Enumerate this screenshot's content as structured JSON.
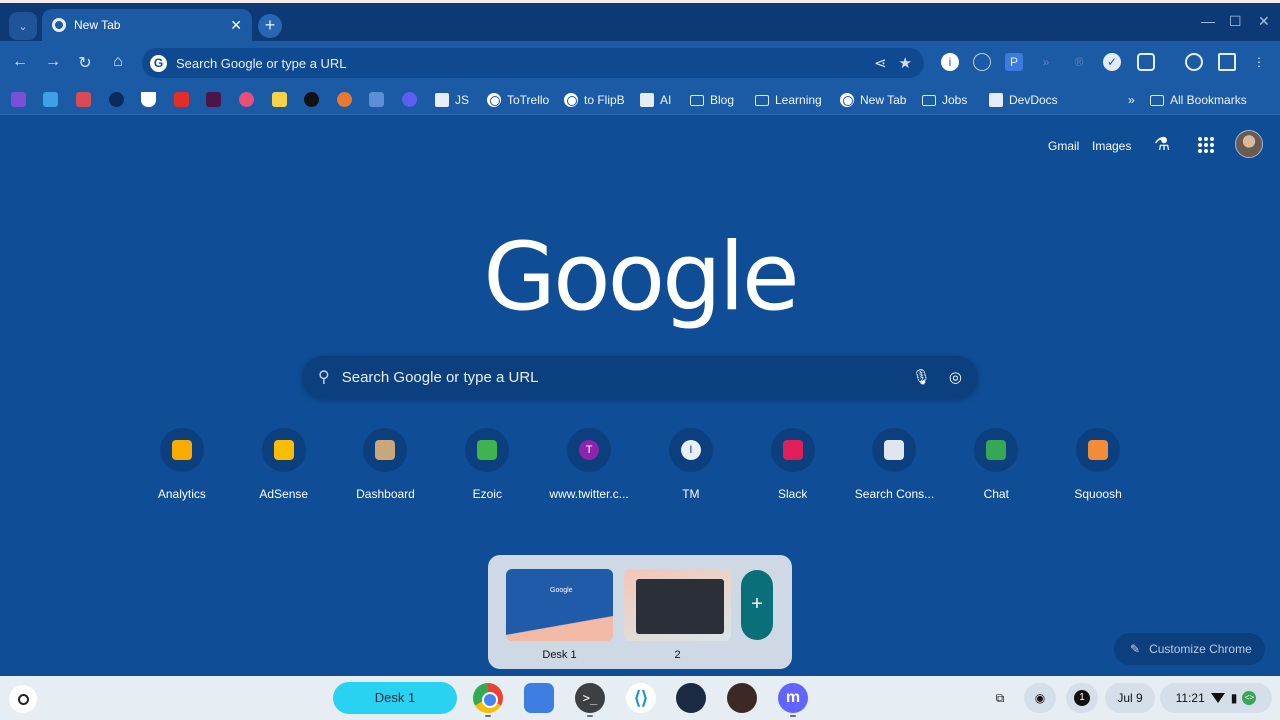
{
  "browser": {
    "tab": {
      "title": "New Tab",
      "close": "✕"
    },
    "new_tab_icon": "+",
    "window_controls": [
      "—",
      "☐",
      "✕"
    ],
    "omnibox": {
      "text": "Search Google or type a URL"
    },
    "bookmarks": [
      {
        "label": "JS",
        "icon": "page"
      },
      {
        "label": "ToTrello",
        "icon": "globe"
      },
      {
        "label": "to FlipB",
        "icon": "globe"
      },
      {
        "label": "AI",
        "icon": "page"
      },
      {
        "label": "Blog",
        "icon": "folder"
      },
      {
        "label": "Learning",
        "icon": "folder"
      },
      {
        "label": "New Tab",
        "icon": "globe"
      },
      {
        "label": "Jobs",
        "icon": "folder"
      },
      {
        "label": "DevDocs",
        "icon": "page"
      }
    ],
    "bookmarks_overflow": "»",
    "all_bookmarks": "All Bookmarks"
  },
  "ntp": {
    "links": {
      "gmail": "Gmail",
      "images": "Images"
    },
    "logo": "Google",
    "search_placeholder": "Search Google or type a URL",
    "shortcuts": [
      {
        "label": "Analytics",
        "color": "#f9ab00"
      },
      {
        "label": "AdSense",
        "color": "#fbbc04"
      },
      {
        "label": "Dashboard",
        "color": "#c9a77a"
      },
      {
        "label": "Ezoic",
        "color": "#3fb34f"
      },
      {
        "label": "www.twitter.c...",
        "color": "#8e24aa",
        "letter": "T"
      },
      {
        "label": "TM",
        "color": "#e8f0f2",
        "letter": "I"
      },
      {
        "label": "Slack",
        "color": "#e01e5a"
      },
      {
        "label": "Search Cons...",
        "color": "#dfe6ee"
      },
      {
        "label": "Chat",
        "color": "#34a853"
      },
      {
        "label": "Squoosh",
        "color": "#f28c38"
      }
    ],
    "customize": "Customize Chrome"
  },
  "desks": {
    "items": [
      {
        "name": "Desk 1"
      },
      {
        "name": "2"
      }
    ],
    "add_label": "+"
  },
  "shelf": {
    "desk_chip": "Desk 1",
    "apps": [
      "chrome",
      "files",
      "terminal",
      "vscode",
      "steam",
      "squoosh",
      "mastodon"
    ],
    "notification_count": "1",
    "date": "Jul 9",
    "time": "11:21"
  }
}
